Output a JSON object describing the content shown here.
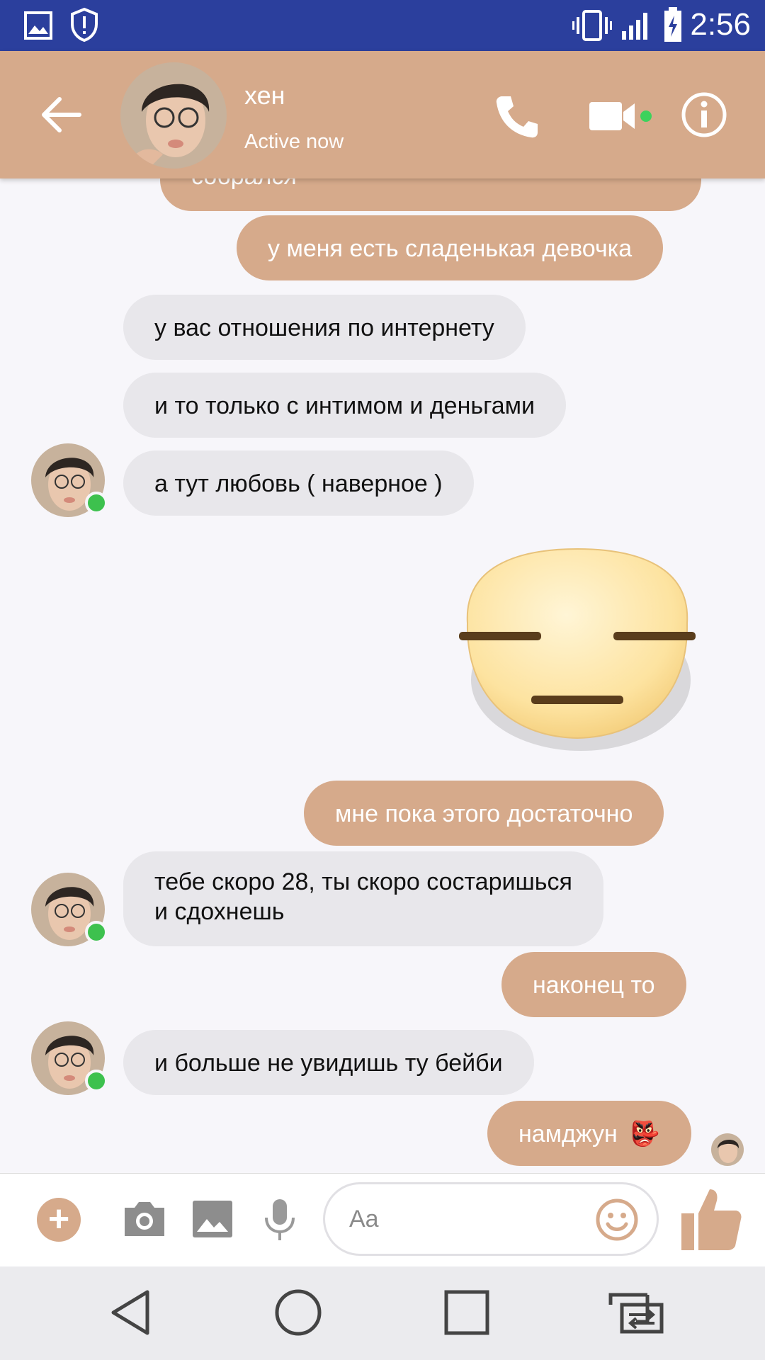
{
  "status_bar": {
    "time": "2:56",
    "icons": [
      "image-icon",
      "shield-icon",
      "vibrate-icon",
      "signal-icon",
      "battery-charging-icon"
    ]
  },
  "header": {
    "contact_name": "хен",
    "status": "Active now",
    "actions": [
      "back-arrow-icon",
      "phone-icon",
      "video-camera-icon",
      "info-icon"
    ]
  },
  "messages": [
    {
      "dir": "out",
      "text": "собрался"
    },
    {
      "dir": "out",
      "text": "у меня есть сладенькая девочка"
    },
    {
      "dir": "in",
      "text": "у вас отношения по интернету"
    },
    {
      "dir": "in",
      "text": "и то только с интимом и деньгами"
    },
    {
      "dir": "in",
      "text": "а тут любовь ( наверное )"
    },
    {
      "dir": "out",
      "type": "sticker",
      "sticker": "expressionless-face"
    },
    {
      "dir": "out",
      "text": "мне пока этого достаточно"
    },
    {
      "dir": "in",
      "text_line1": "тебе скоро 28, ты скоро состаришься",
      "text_line2": "и сдохнешь"
    },
    {
      "dir": "out",
      "text": "наконец то"
    },
    {
      "dir": "in",
      "text": "и больше не увидишь ту бейби"
    },
    {
      "dir": "out",
      "text": "намджун",
      "emoji": "👺"
    }
  ],
  "composer": {
    "placeholder": "Aa",
    "tools": [
      "plus-icon",
      "camera-icon",
      "gallery-icon",
      "microphone-icon",
      "emoji-icon",
      "thumbs-up-icon"
    ]
  },
  "nav_bar": {
    "buttons": [
      "back-triangle-icon",
      "home-circle-icon",
      "recents-square-icon",
      "switch-apps-icon"
    ]
  },
  "colors": {
    "status_bar": "#2b3f9d",
    "accent": "#d6aa8b",
    "incoming_bubble": "#e8e7eb",
    "online": "#3dc14e"
  }
}
